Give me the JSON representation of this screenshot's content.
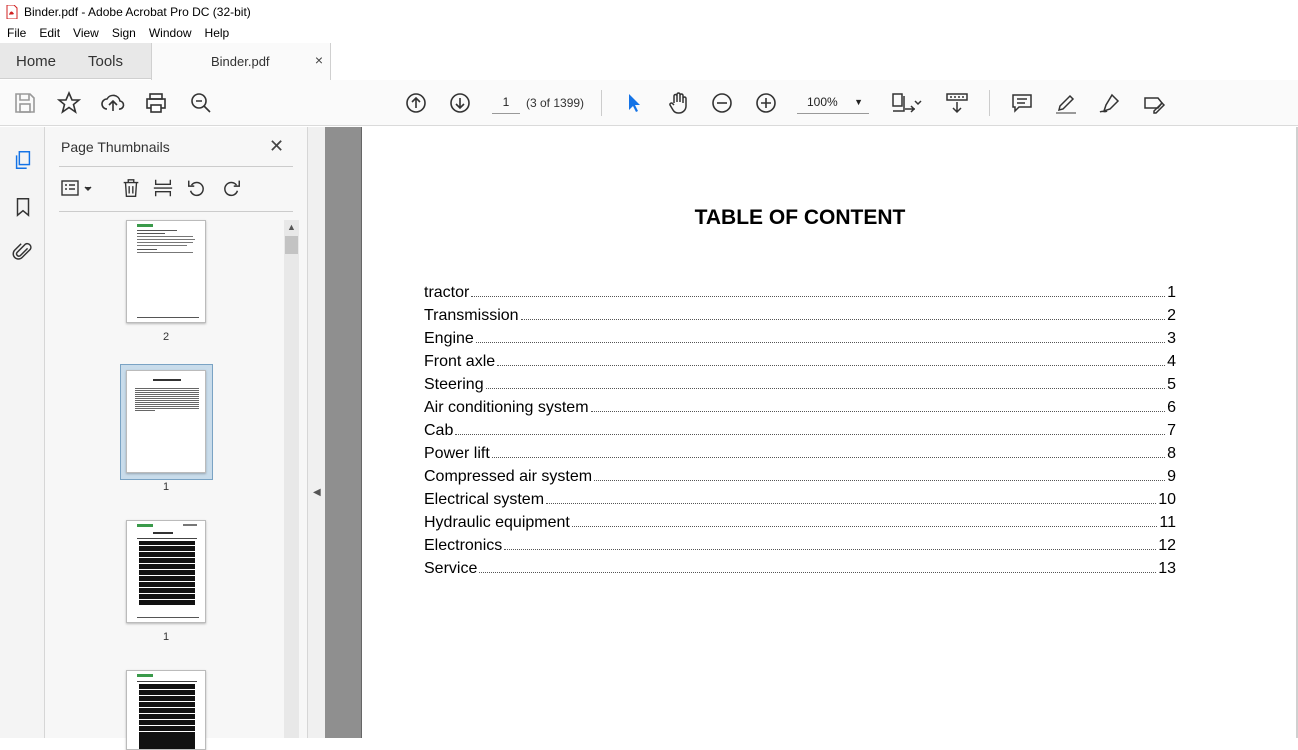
{
  "window": {
    "title": "Binder.pdf - Adobe Acrobat Pro DC (32-bit)"
  },
  "menu": [
    "File",
    "Edit",
    "View",
    "Sign",
    "Window",
    "Help"
  ],
  "tabs": {
    "home": "Home",
    "tools": "Tools",
    "document": "Binder.pdf",
    "close_glyph": "×"
  },
  "toolbar": {
    "page_input": "1",
    "page_count": "(3 of 1399)",
    "zoom": "100%"
  },
  "icons": {
    "save": "save-icon",
    "bookmark_star": "star-icon",
    "upload": "upload-icon",
    "print": "print-icon",
    "search": "search-zoom-icon",
    "prev": "page-up-icon",
    "next": "page-down-icon",
    "select": "arrow-pointer-icon",
    "hand": "hand-icon",
    "zoom_out": "zoom-out-icon",
    "zoom_in": "zoom-in-icon",
    "fit": "fit-page-icon",
    "scroll": "scroll-mode-icon",
    "comment": "comment-icon",
    "highlight": "highlight-icon",
    "sign": "sign-icon",
    "fill_sign": "fill-sign-icon"
  },
  "panel": {
    "title": "Page Thumbnails",
    "close_glyph": "✕",
    "thumbnails": [
      {
        "label": "2"
      },
      {
        "label": "1"
      },
      {
        "label": "1"
      }
    ]
  },
  "colors": {
    "accent": "#1473e6",
    "selection": "#c9dceb",
    "doc_bg": "#8f8f8f"
  },
  "document": {
    "title": "TABLE OF CONTENT",
    "toc": [
      {
        "title": "tractor",
        "page": "1"
      },
      {
        "title": "Transmission",
        "page": "2"
      },
      {
        "title": "Engine",
        "page": "3"
      },
      {
        "title": "Front axle",
        "page": "4"
      },
      {
        "title": "Steering",
        "page": "5"
      },
      {
        "title": "Air conditioning system",
        "page": "6"
      },
      {
        "title": "Cab",
        "page": "7"
      },
      {
        "title": "Power lift",
        "page": "8"
      },
      {
        "title": "Compressed air system",
        "page": "9"
      },
      {
        "title": "Electrical system",
        "page": "10"
      },
      {
        "title": "Hydraulic equipment",
        "page": "11"
      },
      {
        "title": "Electronics",
        "page": "12"
      },
      {
        "title": "Service",
        "page": "13"
      }
    ]
  }
}
